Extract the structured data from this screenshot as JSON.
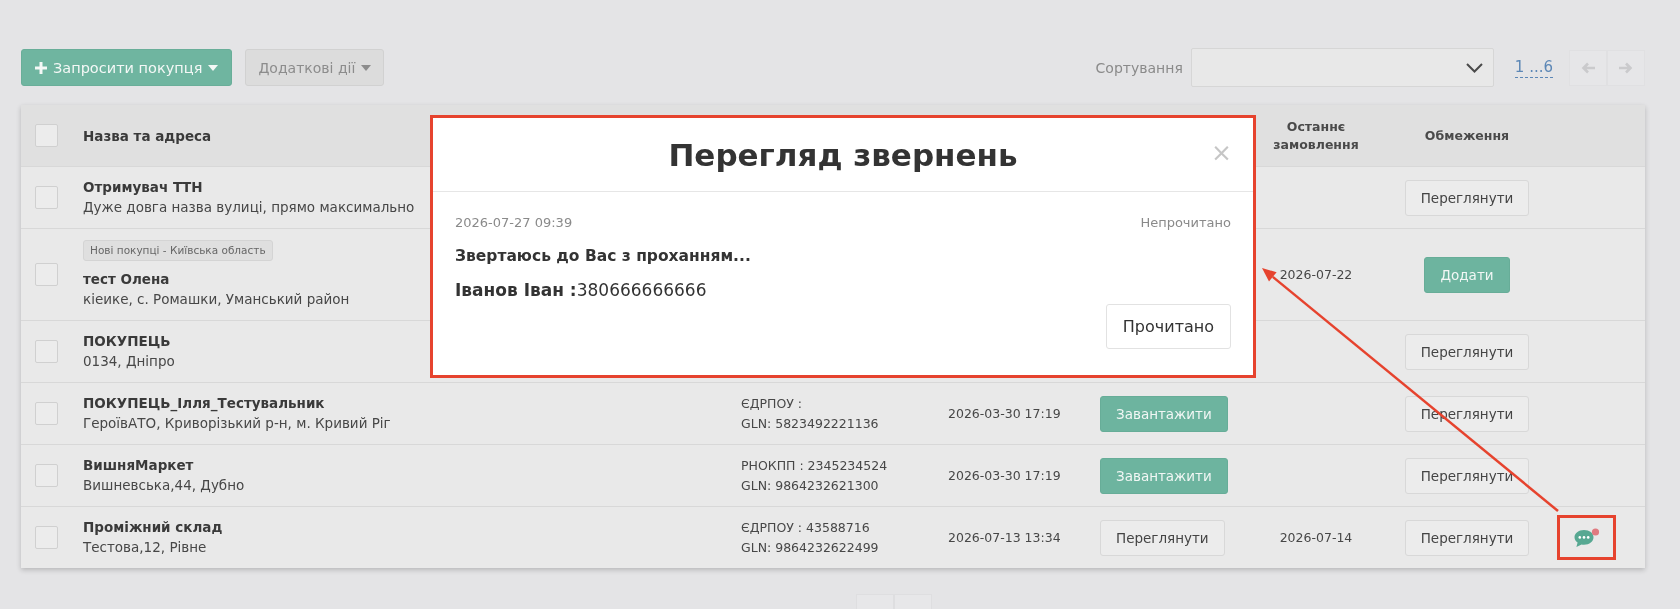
{
  "toolbar": {
    "invite_button": {
      "label": "Запросити покупця"
    },
    "actions_button": {
      "label": "Додаткові дії"
    },
    "sort": {
      "label": "Сортування"
    },
    "pagination": {
      "pages": "1 ...6",
      "previous": {
        "disabled": true
      },
      "next": {
        "disabled": true
      }
    }
  },
  "table": {
    "header": {
      "select_all": {
        "checked": false
      },
      "name": "Назва та адреса",
      "last_order": "Останнє замовлення",
      "restrictions": "Обмеження"
    },
    "rows": [
      {
        "checked": false,
        "name": "Отримувач ТТН",
        "address": "Дуже довга назва вулиці, прямо максимально",
        "restriction": {
          "kind": "default",
          "label": "Переглянути"
        }
      },
      {
        "checked": false,
        "tag": "Нові покупці - Київська область",
        "name": "тест Олена",
        "address": "кіеике, с. Ромашки, Уманський район",
        "last_order": "2026-07-22",
        "restriction": {
          "kind": "primary",
          "label": "Додати"
        }
      },
      {
        "checked": false,
        "name": "ПОКУПЕЦЬ",
        "address": "0134, Дніпро",
        "restriction": {
          "kind": "default",
          "label": "Переглянути"
        }
      },
      {
        "checked": false,
        "name": "ПОКУПЕЦЬ_Ілля_Тестувальник",
        "address": "ГероївАТО, Криворізький р-н, м. Кривий Ріг",
        "codes": [
          "ЄДРПОУ :",
          "GLN: 5823492221136"
        ],
        "date": "2026-03-30 17:19",
        "action": {
          "kind": "primary",
          "label": "Завантажити"
        },
        "restriction": {
          "kind": "default",
          "label": "Переглянути"
        }
      },
      {
        "checked": false,
        "name": "ВишняМаркет",
        "address": "Вишневська,44, Дубно",
        "codes": [
          "РНОКПП : 2345234524",
          "GLN: 9864232621300"
        ],
        "date": "2026-03-30 17:19",
        "action": {
          "kind": "primary",
          "label": "Завантажити"
        },
        "restriction": {
          "kind": "default",
          "label": "Переглянути"
        }
      },
      {
        "checked": false,
        "name": "Проміжний склад",
        "address": "Тестова,12, Рівне",
        "codes": [
          "ЄДРПОУ : 43588716",
          "GLN: 9864232622499"
        ],
        "date": "2026-07-13 13:34",
        "action": {
          "kind": "default",
          "label": "Переглянути"
        },
        "last_order": "2026-07-14",
        "restriction": {
          "kind": "default",
          "label": "Переглянути"
        },
        "chat": {
          "unread": true
        }
      }
    ]
  },
  "modal": {
    "title": "Перегляд звернень",
    "close": "×",
    "messages": [
      {
        "time": "2026-07-27 09:39",
        "status": "Непрочитано",
        "text": "Звертаюсь до Вас з проханням...",
        "author": "**Іванов Іван :**380666666666"
      }
    ],
    "button": "Прочитано"
  }
}
